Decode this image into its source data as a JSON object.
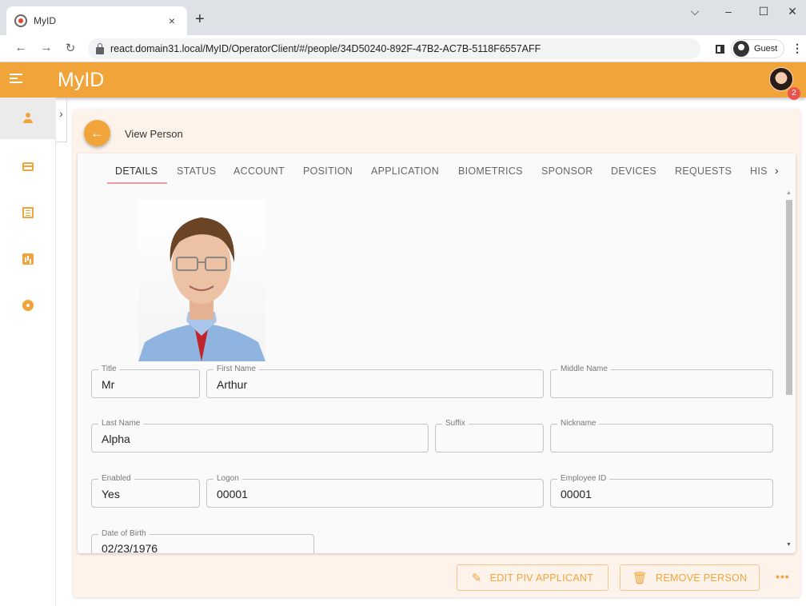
{
  "browser": {
    "tab_title": "MyID",
    "tab_close": "×",
    "new_tab": "+",
    "url": "react.domain31.local/MyID/OperatorClient/#/people/34D50240-892F-47B2-AC7B-5118F6557AFF",
    "profile": "Guest"
  },
  "app": {
    "brand": "MyID",
    "notification_count": "2",
    "accent_color": "#f1a43a"
  },
  "page": {
    "title": "View Person"
  },
  "tabs": [
    {
      "label": "DETAILS",
      "active": true
    },
    {
      "label": "STATUS"
    },
    {
      "label": "ACCOUNT"
    },
    {
      "label": "POSITION"
    },
    {
      "label": "APPLICATION"
    },
    {
      "label": "BIOMETRICS"
    },
    {
      "label": "SPONSOR"
    },
    {
      "label": "DEVICES"
    },
    {
      "label": "REQUESTS"
    },
    {
      "label": "HIS"
    }
  ],
  "fields": {
    "title": {
      "label": "Title",
      "value": "Mr"
    },
    "first_name": {
      "label": "First Name",
      "value": "Arthur"
    },
    "middle_name": {
      "label": "Middle Name",
      "value": ""
    },
    "last_name": {
      "label": "Last Name",
      "value": "Alpha"
    },
    "suffix": {
      "label": "Suffix",
      "value": ""
    },
    "nickname": {
      "label": "Nickname",
      "value": ""
    },
    "enabled": {
      "label": "Enabled",
      "value": "Yes"
    },
    "logon": {
      "label": "Logon",
      "value": "00001"
    },
    "employee_id": {
      "label": "Employee ID",
      "value": "00001"
    },
    "date_of_birth": {
      "label": "Date of Birth",
      "value": "02/23/1976"
    }
  },
  "actions": {
    "edit": "EDIT PIV APPLICANT",
    "remove": "REMOVE PERSON",
    "more": "•••"
  }
}
